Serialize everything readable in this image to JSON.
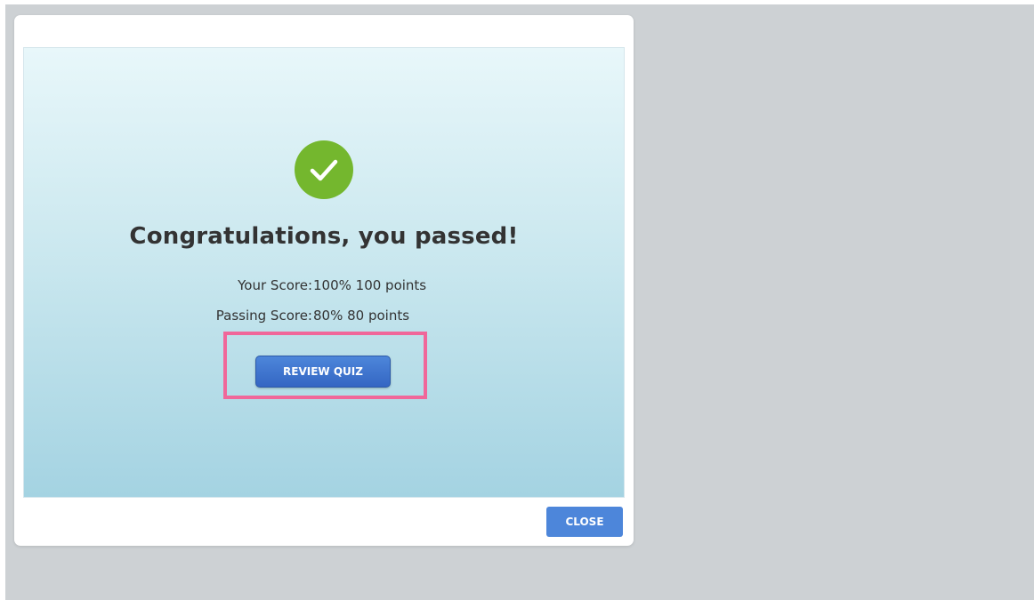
{
  "result": {
    "status_icon": "checkmark-icon",
    "headline": "Congratulations, you passed!",
    "your_score": {
      "label": "Your Score:",
      "value": "100% 100 points"
    },
    "passing_score": {
      "label": "Passing Score:",
      "value": "80% 80 points"
    },
    "review_button_label": "REVIEW QUIZ"
  },
  "dialog": {
    "close_button_label": "CLOSE"
  },
  "colors": {
    "success_green": "#74b72e",
    "button_blue": "#4d86da",
    "highlight_pink": "#f0679a",
    "backdrop_gray": "#cdd1d4"
  }
}
